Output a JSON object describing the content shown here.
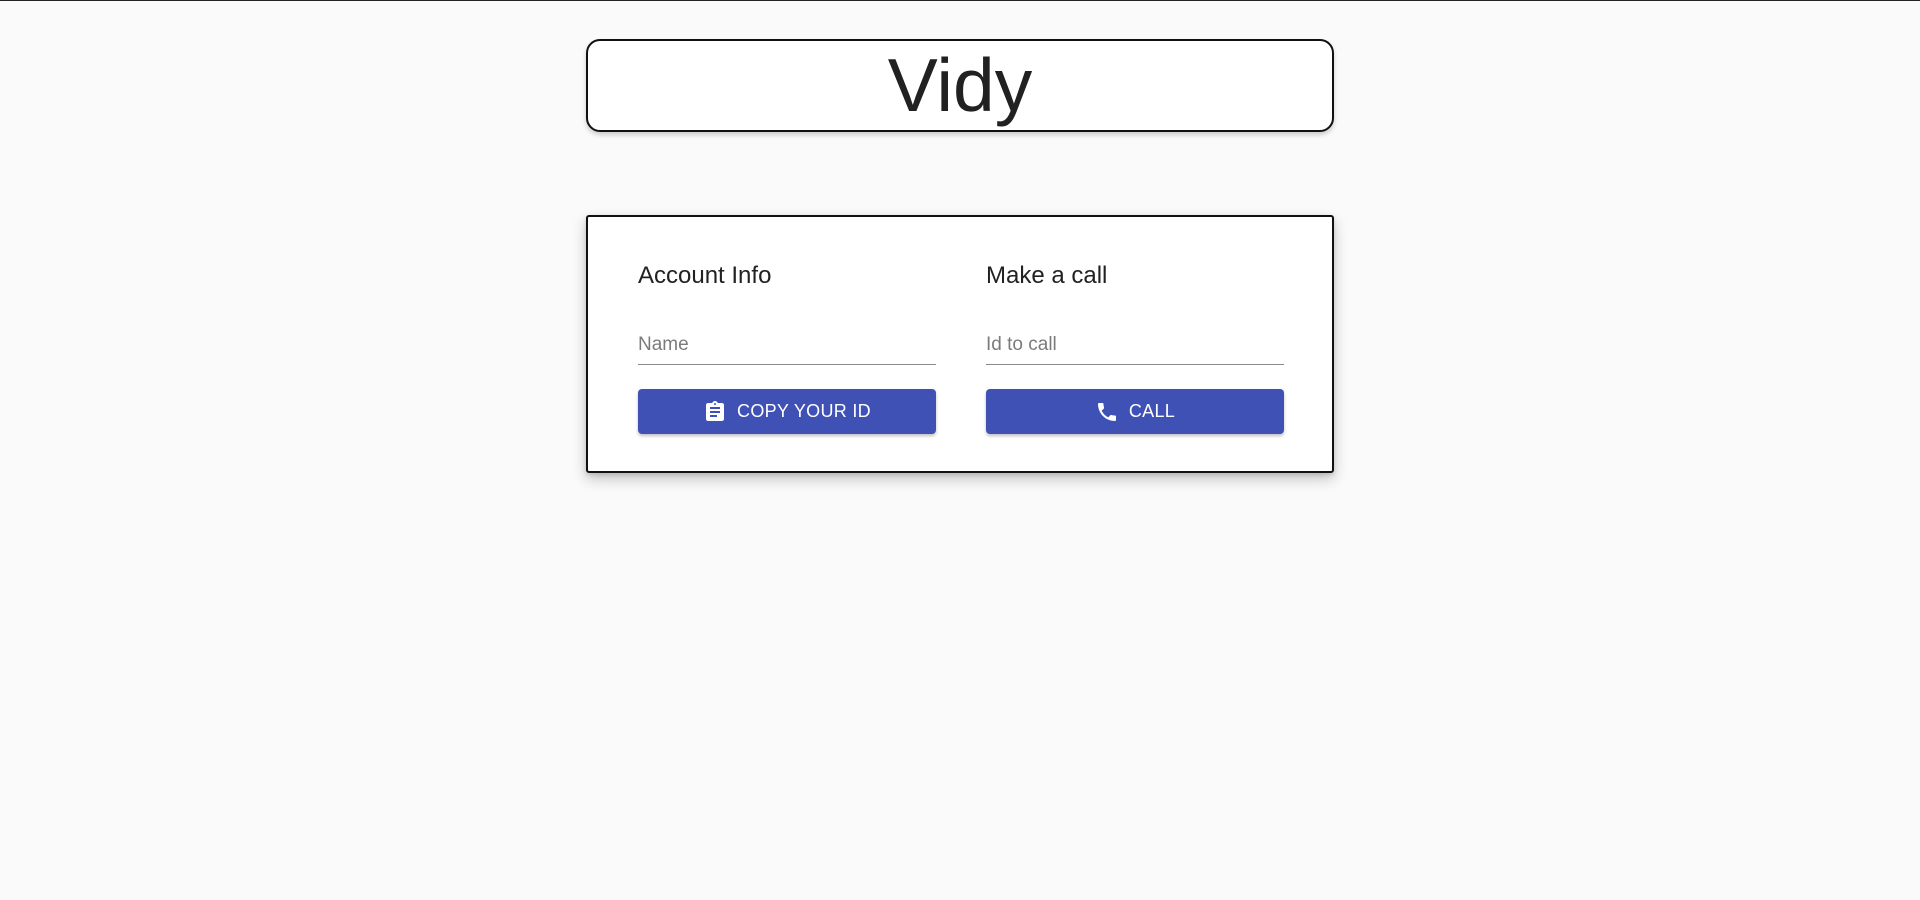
{
  "app": {
    "title": "Vidy"
  },
  "account_info": {
    "heading": "Account Info",
    "name_input": {
      "placeholder": "Name",
      "value": ""
    },
    "copy_button": {
      "label": "COPY YOUR ID",
      "icon": "clipboard-icon"
    }
  },
  "make_call": {
    "heading": "Make a call",
    "id_input": {
      "placeholder": "Id to call",
      "value": ""
    },
    "call_button": {
      "label": "CALL",
      "icon": "phone-icon"
    }
  },
  "colors": {
    "button_primary": "#3f51b5",
    "background": "#fafafa",
    "card": "#ffffff"
  }
}
